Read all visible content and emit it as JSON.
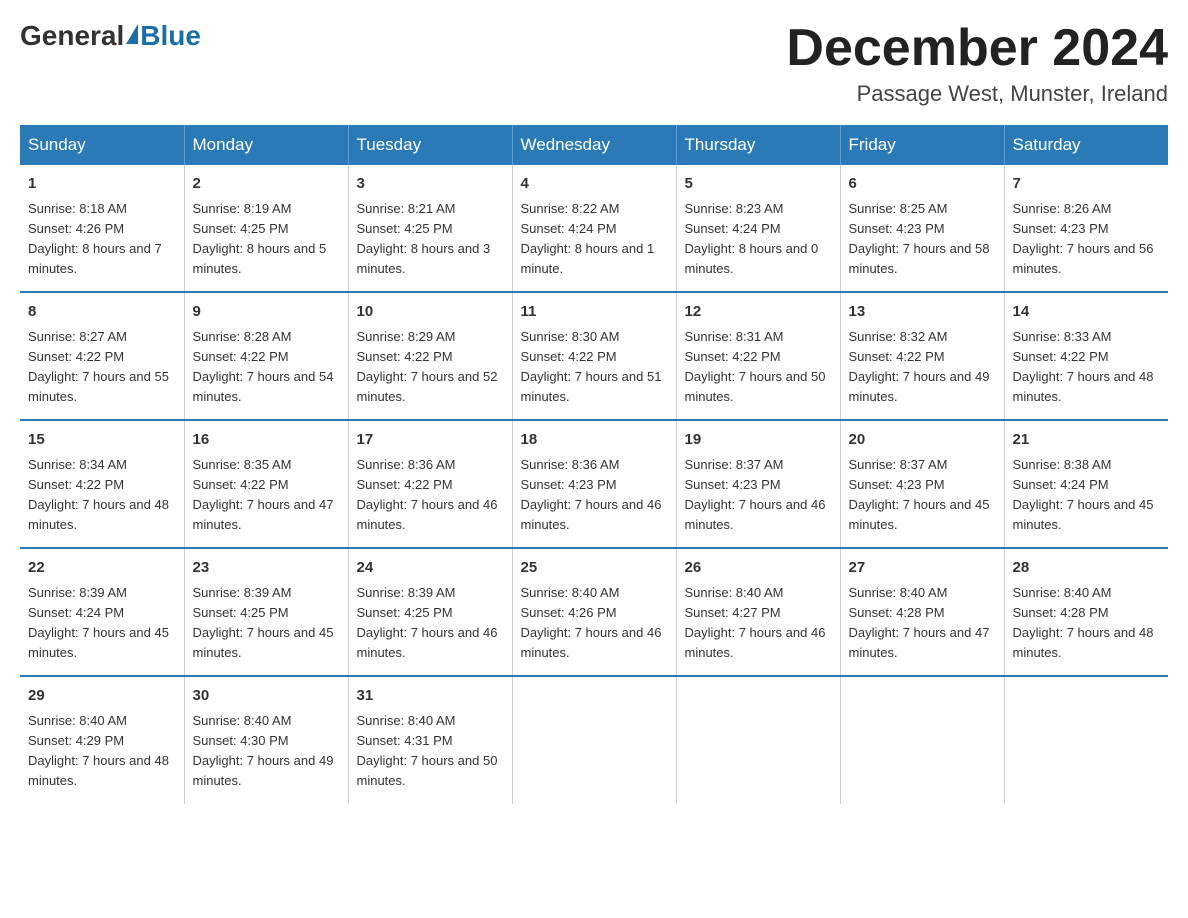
{
  "header": {
    "logo_general": "General",
    "logo_blue": "Blue",
    "month_title": "December 2024",
    "location": "Passage West, Munster, Ireland"
  },
  "weekdays": [
    "Sunday",
    "Monday",
    "Tuesday",
    "Wednesday",
    "Thursday",
    "Friday",
    "Saturday"
  ],
  "weeks": [
    [
      {
        "day": "1",
        "sunrise": "8:18 AM",
        "sunset": "4:26 PM",
        "daylight": "8 hours and 7 minutes."
      },
      {
        "day": "2",
        "sunrise": "8:19 AM",
        "sunset": "4:25 PM",
        "daylight": "8 hours and 5 minutes."
      },
      {
        "day": "3",
        "sunrise": "8:21 AM",
        "sunset": "4:25 PM",
        "daylight": "8 hours and 3 minutes."
      },
      {
        "day": "4",
        "sunrise": "8:22 AM",
        "sunset": "4:24 PM",
        "daylight": "8 hours and 1 minute."
      },
      {
        "day": "5",
        "sunrise": "8:23 AM",
        "sunset": "4:24 PM",
        "daylight": "8 hours and 0 minutes."
      },
      {
        "day": "6",
        "sunrise": "8:25 AM",
        "sunset": "4:23 PM",
        "daylight": "7 hours and 58 minutes."
      },
      {
        "day": "7",
        "sunrise": "8:26 AM",
        "sunset": "4:23 PM",
        "daylight": "7 hours and 56 minutes."
      }
    ],
    [
      {
        "day": "8",
        "sunrise": "8:27 AM",
        "sunset": "4:22 PM",
        "daylight": "7 hours and 55 minutes."
      },
      {
        "day": "9",
        "sunrise": "8:28 AM",
        "sunset": "4:22 PM",
        "daylight": "7 hours and 54 minutes."
      },
      {
        "day": "10",
        "sunrise": "8:29 AM",
        "sunset": "4:22 PM",
        "daylight": "7 hours and 52 minutes."
      },
      {
        "day": "11",
        "sunrise": "8:30 AM",
        "sunset": "4:22 PM",
        "daylight": "7 hours and 51 minutes."
      },
      {
        "day": "12",
        "sunrise": "8:31 AM",
        "sunset": "4:22 PM",
        "daylight": "7 hours and 50 minutes."
      },
      {
        "day": "13",
        "sunrise": "8:32 AM",
        "sunset": "4:22 PM",
        "daylight": "7 hours and 49 minutes."
      },
      {
        "day": "14",
        "sunrise": "8:33 AM",
        "sunset": "4:22 PM",
        "daylight": "7 hours and 48 minutes."
      }
    ],
    [
      {
        "day": "15",
        "sunrise": "8:34 AM",
        "sunset": "4:22 PM",
        "daylight": "7 hours and 48 minutes."
      },
      {
        "day": "16",
        "sunrise": "8:35 AM",
        "sunset": "4:22 PM",
        "daylight": "7 hours and 47 minutes."
      },
      {
        "day": "17",
        "sunrise": "8:36 AM",
        "sunset": "4:22 PM",
        "daylight": "7 hours and 46 minutes."
      },
      {
        "day": "18",
        "sunrise": "8:36 AM",
        "sunset": "4:23 PM",
        "daylight": "7 hours and 46 minutes."
      },
      {
        "day": "19",
        "sunrise": "8:37 AM",
        "sunset": "4:23 PM",
        "daylight": "7 hours and 46 minutes."
      },
      {
        "day": "20",
        "sunrise": "8:37 AM",
        "sunset": "4:23 PM",
        "daylight": "7 hours and 45 minutes."
      },
      {
        "day": "21",
        "sunrise": "8:38 AM",
        "sunset": "4:24 PM",
        "daylight": "7 hours and 45 minutes."
      }
    ],
    [
      {
        "day": "22",
        "sunrise": "8:39 AM",
        "sunset": "4:24 PM",
        "daylight": "7 hours and 45 minutes."
      },
      {
        "day": "23",
        "sunrise": "8:39 AM",
        "sunset": "4:25 PM",
        "daylight": "7 hours and 45 minutes."
      },
      {
        "day": "24",
        "sunrise": "8:39 AM",
        "sunset": "4:25 PM",
        "daylight": "7 hours and 46 minutes."
      },
      {
        "day": "25",
        "sunrise": "8:40 AM",
        "sunset": "4:26 PM",
        "daylight": "7 hours and 46 minutes."
      },
      {
        "day": "26",
        "sunrise": "8:40 AM",
        "sunset": "4:27 PM",
        "daylight": "7 hours and 46 minutes."
      },
      {
        "day": "27",
        "sunrise": "8:40 AM",
        "sunset": "4:28 PM",
        "daylight": "7 hours and 47 minutes."
      },
      {
        "day": "28",
        "sunrise": "8:40 AM",
        "sunset": "4:28 PM",
        "daylight": "7 hours and 48 minutes."
      }
    ],
    [
      {
        "day": "29",
        "sunrise": "8:40 AM",
        "sunset": "4:29 PM",
        "daylight": "7 hours and 48 minutes."
      },
      {
        "day": "30",
        "sunrise": "8:40 AM",
        "sunset": "4:30 PM",
        "daylight": "7 hours and 49 minutes."
      },
      {
        "day": "31",
        "sunrise": "8:40 AM",
        "sunset": "4:31 PM",
        "daylight": "7 hours and 50 minutes."
      },
      null,
      null,
      null,
      null
    ]
  ],
  "labels": {
    "sunrise": "Sunrise:",
    "sunset": "Sunset:",
    "daylight": "Daylight:"
  }
}
